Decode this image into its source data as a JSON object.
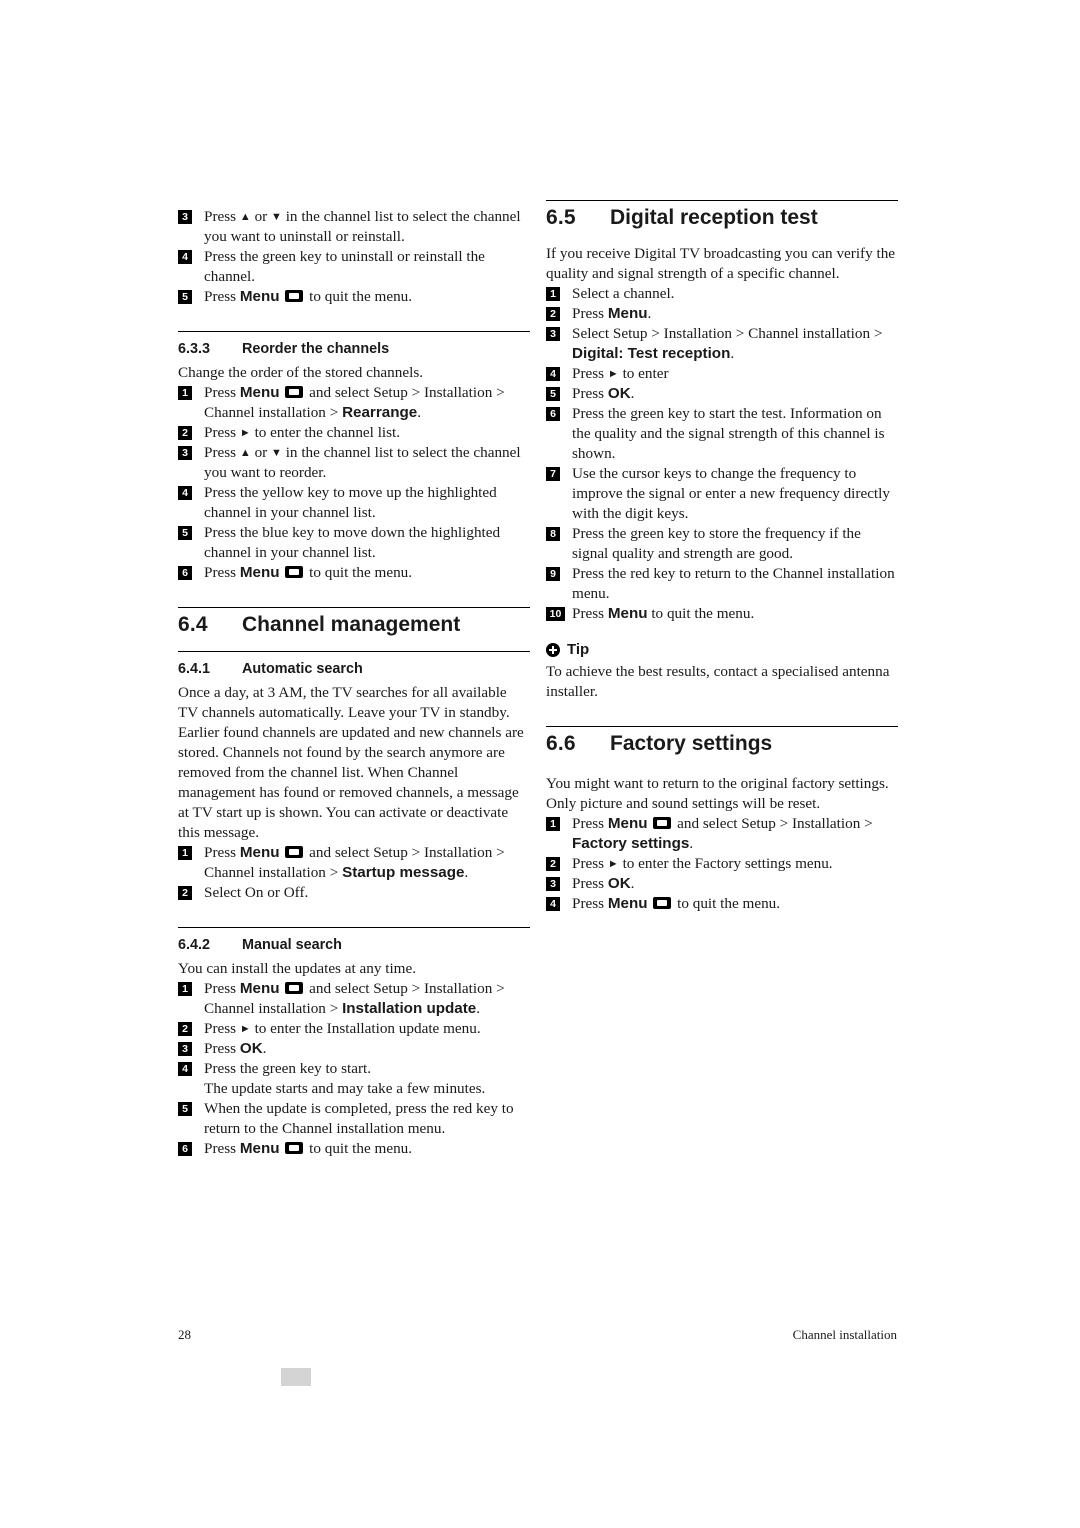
{
  "document": {
    "footer": {
      "page_number": "28",
      "chapter": "Channel installation"
    }
  },
  "left_column": {
    "top_steps": [
      {
        "num": "3",
        "text": "Press ▲ or ▼ in the channel list to select the channel you want to uninstall or reinstall."
      },
      {
        "num": "4",
        "text": "Press the green key to uninstall or reinstall the channel."
      },
      {
        "num": "5",
        "text": "Press Menu ▣ to quit the menu."
      }
    ],
    "section_633": {
      "number": "6.3.3",
      "title": "Reorder the channels",
      "intro": "Change the order of the stored channels.",
      "steps": [
        {
          "num": "1",
          "text": "Press Menu ▣ and select Setup > Installation > Channel installation > Rearrange."
        },
        {
          "num": "2",
          "text": "Press ► to enter the channel list."
        },
        {
          "num": "3",
          "text": "Press ▲ or ▼ in the channel list to select the channel you want to reorder."
        },
        {
          "num": "4",
          "text": "Press the yellow key to move up the highlighted channel in your channel list."
        },
        {
          "num": "5",
          "text": "Press the blue key to move down the highlighted channel in your channel list."
        },
        {
          "num": "6",
          "text": "Press Menu ▣ to quit the menu."
        }
      ]
    },
    "section_64": {
      "number": "6.4",
      "title": "Channel management"
    },
    "section_641": {
      "number": "6.4.1",
      "title": "Automatic search",
      "para1": "Once a day, at 3 AM, the TV searches for all available TV channels automatically. Leave your TV in standby.",
      "para2": "Earlier found channels are updated and new channels are stored. Channels not found by the search anymore are removed from the channel list. When Channel management has found or removed channels, a message at TV start up is shown. You can activate or deactivate this message.",
      "steps": [
        {
          "num": "1",
          "text": "Press Menu ▣ and select Setup > Installation > Channel installation > Startup message."
        },
        {
          "num": "2",
          "text": "Select On or Off."
        }
      ]
    },
    "section_642": {
      "number": "6.4.2",
      "title": "Manual search",
      "intro": "You can install the updates at any time.",
      "steps": [
        {
          "num": "1",
          "text": "Press Menu ▣ and select Setup > Installation > Channel installation > Installation update."
        },
        {
          "num": "2",
          "text": "Press ► to enter the Installation update menu."
        },
        {
          "num": "3",
          "text": "Press OK."
        },
        {
          "num": "4",
          "text": "Press the green key to start. The update starts and may take a few minutes."
        },
        {
          "num": "5",
          "text": "When the update is completed, press the red key to return to the Channel installation menu."
        },
        {
          "num": "6",
          "text": "Press Menu ▣ to quit the menu."
        }
      ]
    }
  },
  "right_column": {
    "section_65": {
      "number": "6.5",
      "title": "Digital reception test",
      "intro": "If you receive Digital TV broadcasting you can verify the quality and signal strength of a specific channel.",
      "steps": [
        {
          "num": "1",
          "text": "Select a channel."
        },
        {
          "num": "2",
          "text": "Press Menu."
        },
        {
          "num": "3",
          "text": "Select Setup > Installation > Channel installation > Digital: Test reception."
        },
        {
          "num": "4",
          "text": "Press ► to enter"
        },
        {
          "num": "5",
          "text": "Press OK."
        },
        {
          "num": "6",
          "text": "Press the green key to start the test. Information on the quality and the signal strength of this channel is shown."
        },
        {
          "num": "7",
          "text": "Use the cursor keys to change the frequency to improve the signal or enter a new frequency directly with the digit keys."
        },
        {
          "num": "8",
          "text": "Press the green key to store the frequency if the signal quality and strength are good."
        },
        {
          "num": "9",
          "text": "Press the red key to return to the Channel installation menu."
        },
        {
          "num": "10",
          "text": "Press Menu to quit the menu."
        }
      ],
      "tip": {
        "title": "Tip",
        "text": "To achieve the best results, contact a specialised antenna installer."
      }
    },
    "section_66": {
      "number": "6.6",
      "title": "Factory settings",
      "intro": "You might want to return to the original factory settings. Only picture and sound settings will be reset.",
      "steps": [
        {
          "num": "1",
          "text": "Press Menu ▣ and select Setup > Installation > Factory settings."
        },
        {
          "num": "2",
          "text": "Press ► to enter the Factory settings menu."
        },
        {
          "num": "3",
          "text": "Press OK."
        },
        {
          "num": "4",
          "text": "Press Menu ▣ to quit the menu."
        }
      ]
    }
  }
}
